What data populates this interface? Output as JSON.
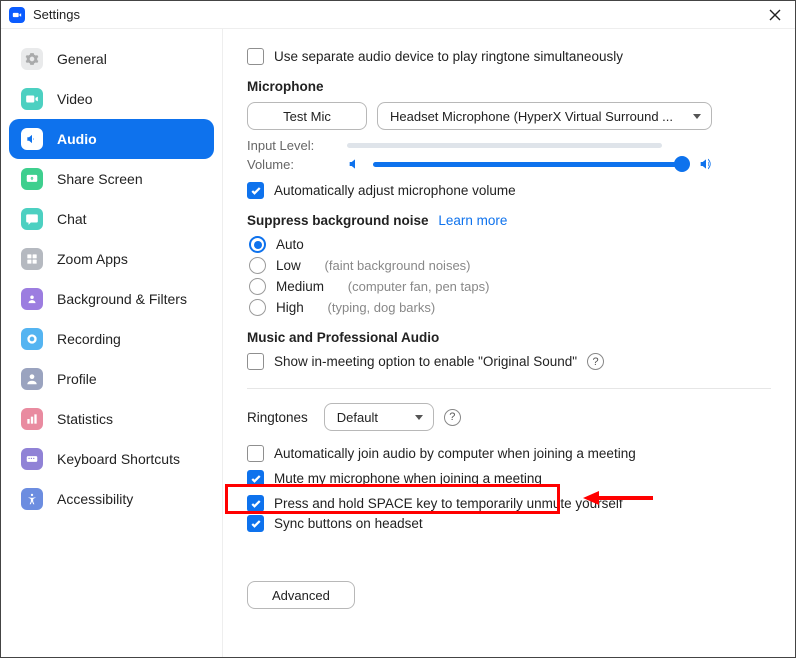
{
  "window": {
    "title": "Settings"
  },
  "sidebar": {
    "items": [
      {
        "label": "General"
      },
      {
        "label": "Video"
      },
      {
        "label": "Audio"
      },
      {
        "label": "Share Screen"
      },
      {
        "label": "Chat"
      },
      {
        "label": "Zoom Apps"
      },
      {
        "label": "Background & Filters"
      },
      {
        "label": "Recording"
      },
      {
        "label": "Profile"
      },
      {
        "label": "Statistics"
      },
      {
        "label": "Keyboard Shortcuts"
      },
      {
        "label": "Accessibility"
      }
    ]
  },
  "audio": {
    "separate_device": "Use separate audio device to play ringtone simultaneously",
    "mic_section": "Microphone",
    "test_mic": "Test Mic",
    "mic_selected": "Headset Microphone (HyperX Virtual Surround ...",
    "input_level_label": "Input Level:",
    "volume_label": "Volume:",
    "auto_adjust": "Automatically adjust microphone volume",
    "suppress_title": "Suppress background noise",
    "learn_more": "Learn more",
    "noise": {
      "auto": "Auto",
      "low": "Low",
      "low_hint": "(faint background noises)",
      "medium": "Medium",
      "medium_hint": "(computer fan, pen taps)",
      "high": "High",
      "high_hint": "(typing, dog barks)"
    },
    "music_title": "Music and Professional Audio",
    "original_sound": "Show in-meeting option to enable \"Original Sound\"",
    "ringtones_label": "Ringtones",
    "ringtones_value": "Default",
    "auto_join": "Automatically join audio by computer when joining a meeting",
    "mute_on_join": "Mute my microphone when joining a meeting",
    "press_space": "Press and hold SPACE key to temporarily unmute yourself",
    "sync_headset": "Sync buttons on headset",
    "advanced": "Advanced"
  }
}
